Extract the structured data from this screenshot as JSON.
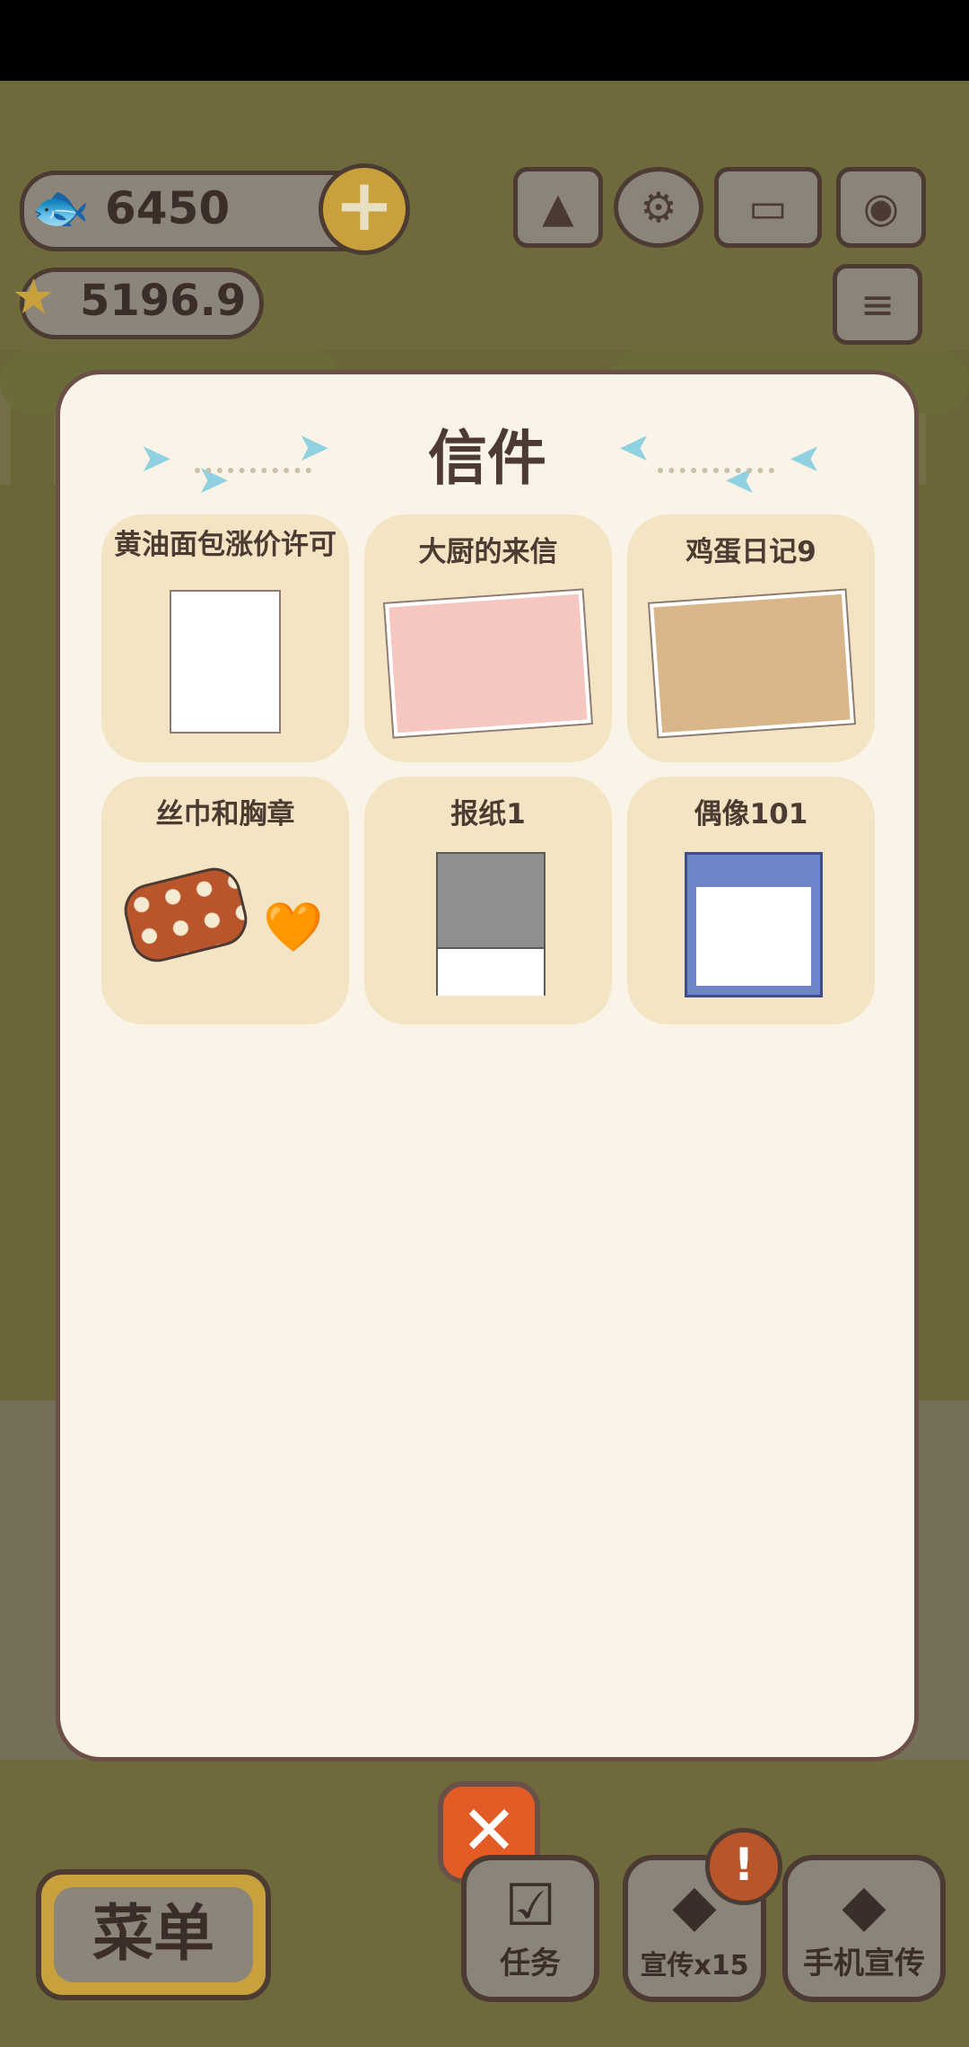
{
  "hud": {
    "fish_count": "6450",
    "star_count": "5196.9",
    "plus_icon": "+",
    "icons": [
      "rank-icon",
      "gear-icon",
      "book-icon",
      "camera-icon",
      "news-icon"
    ]
  },
  "dialog": {
    "title": "信件",
    "letters": [
      {
        "title": "黄油面包涨价许可"
      },
      {
        "title": "大厨的来信"
      },
      {
        "title": "鸡蛋日记9"
      },
      {
        "title": "丝巾和胸章"
      },
      {
        "title": "报纸1"
      },
      {
        "title": "偶像101"
      }
    ],
    "close_symbol": "✕"
  },
  "bottom": {
    "menu_label": "菜单",
    "task_label": "任务",
    "promote_label": "宣传x15",
    "phone_promote_label": "手机宣传",
    "badge_symbol": "!"
  },
  "colors": {
    "accent": "#e45c25",
    "panel": "#faf3e8",
    "card": "#f3e4c3",
    "ink": "#4b3b32"
  }
}
